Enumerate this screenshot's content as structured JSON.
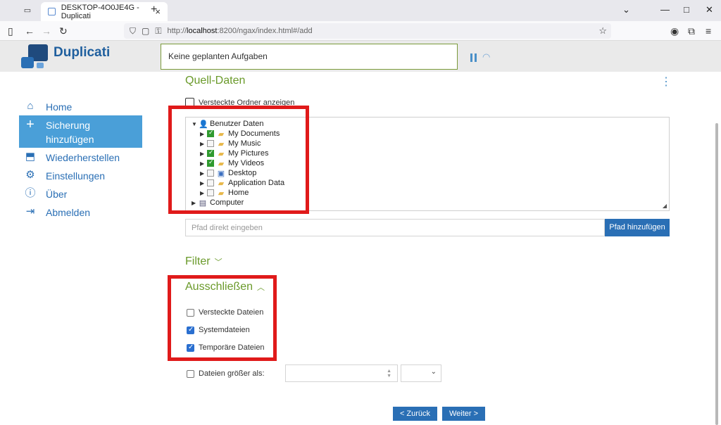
{
  "browser": {
    "tab_title": "DESKTOP-4O0JE4G - Duplicati",
    "url_prefix": "http://",
    "url_host": "localhost",
    "url_rest": ":8200/ngax/index.html#/add"
  },
  "app": {
    "brand": "Duplicati",
    "status": "Keine geplanten Aufgaben"
  },
  "sidebar": {
    "items": [
      {
        "label": "Home",
        "icon": "home-icon"
      },
      {
        "label": "Sicherung hinzufügen",
        "icon": "plus-icon"
      },
      {
        "label": "Wiederherstellen",
        "icon": "restore-icon"
      },
      {
        "label": "Einstellungen",
        "icon": "gear-icon"
      },
      {
        "label": "Über",
        "icon": "info-icon"
      },
      {
        "label": "Abmelden",
        "icon": "logout-icon"
      }
    ]
  },
  "main": {
    "title": "Quell-Daten",
    "show_hidden_folders": "Versteckte Ordner anzeigen",
    "tree": {
      "root": "Benutzer Daten",
      "items": [
        {
          "label": "My Documents",
          "checked": true
        },
        {
          "label": "My Music",
          "checked": false
        },
        {
          "label": "My Pictures",
          "checked": true
        },
        {
          "label": "My Videos",
          "checked": true
        },
        {
          "label": "Desktop",
          "checked": false
        },
        {
          "label": "Application Data",
          "checked": false
        },
        {
          "label": "Home",
          "checked": false
        }
      ],
      "computer": "Computer"
    },
    "path_placeholder": "Pfad direkt eingeben",
    "path_button": "Pfad hinzufügen",
    "filter_title": "Filter",
    "exclude_title": "Ausschließen",
    "exclude": {
      "hidden_files": "Versteckte Dateien",
      "system_files": "Systemdateien",
      "temp_files": "Temporäre Dateien"
    },
    "larger_than": "Dateien größer als:",
    "back_button": "< Zurück",
    "next_button": "Weiter >"
  },
  "colors": {
    "accent": "#2a6fb5",
    "green": "#6a9a2a",
    "highlight": "#e01a1a"
  }
}
